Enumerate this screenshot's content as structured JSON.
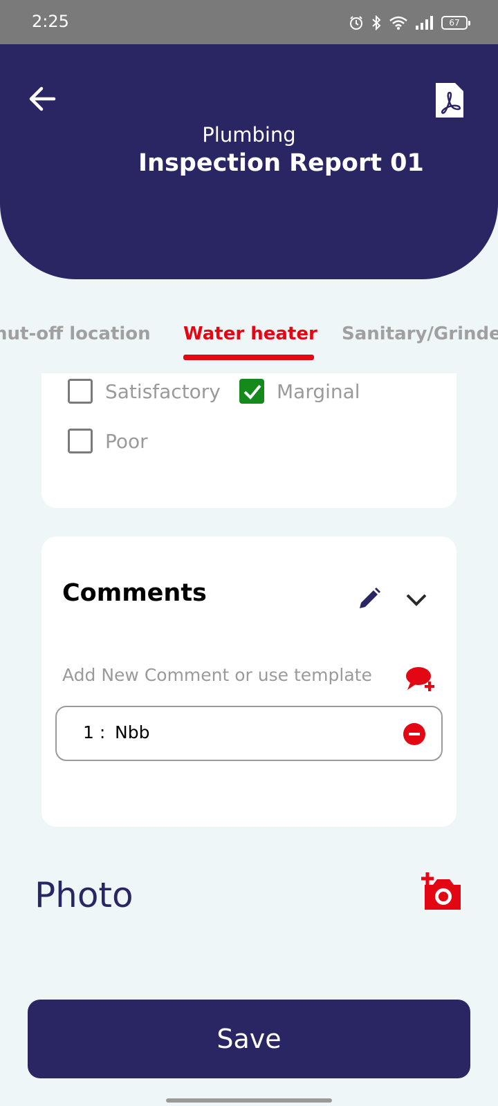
{
  "status_bar": {
    "time": "2:25",
    "battery": "67",
    "icons": [
      "alarm-icon",
      "bluetooth-icon",
      "wifi-icon",
      "signal-icon",
      "battery-icon"
    ]
  },
  "header": {
    "subtitle": "Plumbing",
    "title": "Inspection Report 01",
    "background_color": "#2a2563"
  },
  "tabs": [
    {
      "label": "hut-off location",
      "active": false
    },
    {
      "label": "Water heater",
      "active": true
    },
    {
      "label": "Sanitary/Grinde",
      "active": false
    }
  ],
  "accent_color": "#e30613",
  "condition": {
    "options": [
      {
        "label": "Satisfactory",
        "checked": false
      },
      {
        "label": "Marginal",
        "checked": true
      },
      {
        "label": "Poor",
        "checked": false
      }
    ]
  },
  "comments": {
    "title": "Comments",
    "placeholder": "Add New Comment or use template",
    "items": [
      {
        "number": "1 :",
        "text": "Nbb"
      }
    ]
  },
  "photo": {
    "label": "Photo"
  },
  "save_button": {
    "label": "Save"
  }
}
